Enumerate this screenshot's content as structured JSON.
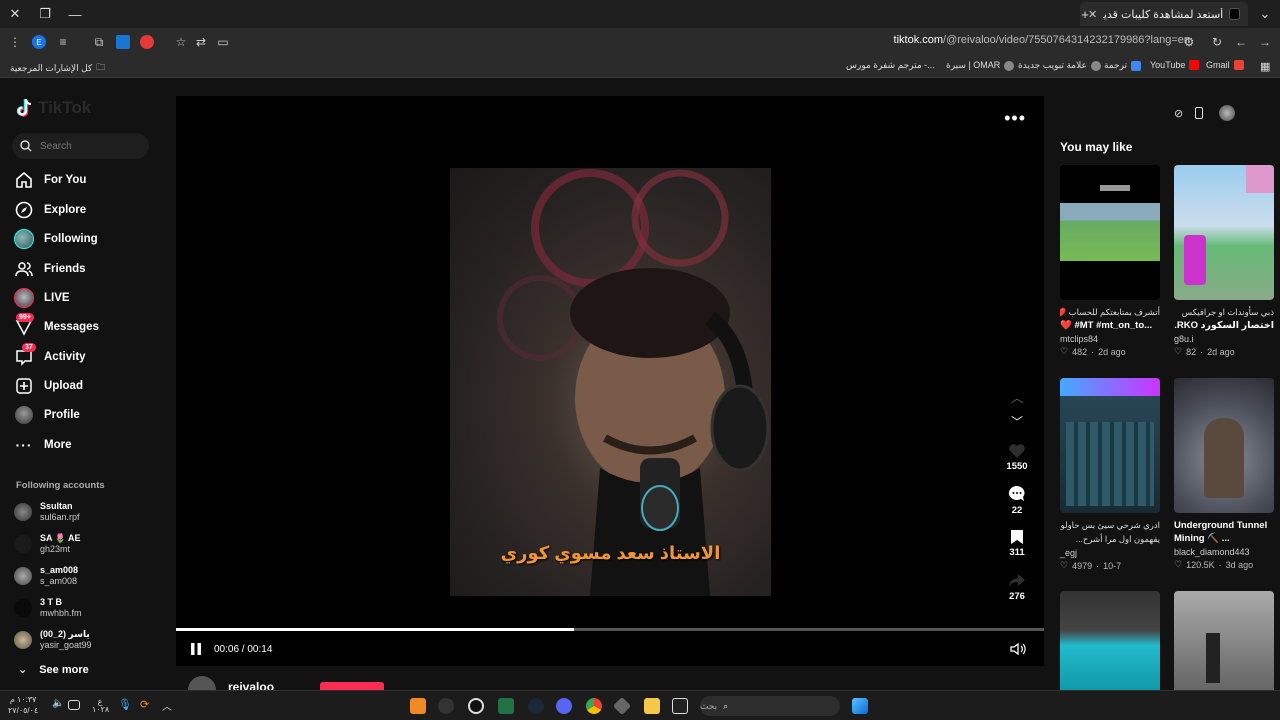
{
  "browser": {
    "tab_title": "أستعد لمشاهدة كليبات قديمة مع",
    "url_domain": "tiktok.com",
    "url_path": "/@reivaloo/video/7550764314232179986?lang=en",
    "bookmarks": [
      {
        "label": "Gmail",
        "color": "#ea4335"
      },
      {
        "label": "YouTube",
        "color": "#ff0000"
      },
      {
        "label": "ترجمة",
        "color": "#4285f4"
      },
      {
        "label": "علامة تبويب جديدة",
        "color": "#888888"
      },
      {
        "label": "سيرة | OMAR",
        "color": "#888888"
      },
      {
        "label": "مترجم شفرة مورس -...",
        "color": "#555555"
      }
    ],
    "all_bookmarks_label": "كل الإشارات المرجعية"
  },
  "sidebar": {
    "logo_text": "TikTok",
    "search_placeholder": "Search",
    "nav": [
      {
        "label": "For You",
        "icon": "home-icon"
      },
      {
        "label": "Explore",
        "icon": "compass-icon"
      },
      {
        "label": "Following",
        "icon": "avatar-icon"
      },
      {
        "label": "Friends",
        "icon": "friends-icon"
      },
      {
        "label": "LIVE",
        "icon": "live-icon"
      },
      {
        "label": "Messages",
        "icon": "messages-icon",
        "badge": "99+"
      },
      {
        "label": "Activity",
        "icon": "activity-icon",
        "badge": "37"
      },
      {
        "label": "Upload",
        "icon": "upload-icon"
      },
      {
        "label": "Profile",
        "icon": "profile-icon"
      },
      {
        "label": "More",
        "icon": "more-icon"
      }
    ],
    "following_title": "Following accounts",
    "accounts": [
      {
        "name": "Ssultan",
        "handle": "sul6an.rpf"
      },
      {
        "name": "SA 🌷 AE",
        "handle": "gh23mt"
      },
      {
        "name": "s_am008",
        "handle": "s_am008"
      },
      {
        "name": "3 T B",
        "handle": "mwhbh.fm"
      },
      {
        "name": "ياسر (2_00)",
        "handle": "yasir_goat99"
      }
    ],
    "see_more": "See more"
  },
  "video": {
    "caption": "الاستاذ سعد مسوي كوري",
    "likes": "1550",
    "comments": "22",
    "saves": "311",
    "shares": "276",
    "time": "00:06 / 00:14",
    "progress": 0.459,
    "author": "reivaloo"
  },
  "right_panel": {
    "title": "You may like",
    "cards": [
      {
        "line1": "أتشرف بمتابعتكم للحساب ❤️",
        "line2": "❤️ #MT #mt_on_to...",
        "author": "mtclips84",
        "likes": "482",
        "date": "2d ago",
        "thumb": "game"
      },
      {
        "line1": "ذبي سأوندات او جرافيكس",
        "line2": "اختصار السكورد RKO...",
        "author": "g8u.i",
        "likes": "82",
        "date": "2d ago",
        "thumb": "purple"
      },
      {
        "line1": "ادري شرحي سيئ بس حاولو",
        "line2": "يفهمون اول مرا أشرح...",
        "author": "_egj",
        "likes": "4979",
        "date": "10-7",
        "thumb": "mixer"
      },
      {
        "line1": "Underground Tunnel",
        "line2": "Mining ⛏️ ...",
        "author": "black_diamond443",
        "likes": "120.5K",
        "date": "3d ago",
        "thumb": "tunnel"
      },
      {
        "line1": "",
        "line2": "",
        "author": "",
        "likes": "",
        "date": "",
        "thumb": "arena"
      },
      {
        "line1": "",
        "line2": "",
        "author": "",
        "likes": "",
        "date": "",
        "thumb": "street"
      }
    ]
  },
  "taskbar": {
    "search_placeholder": "بحث",
    "time": "١٠:٣٧ م",
    "date": "٢٧/٠٥/٠٤",
    "lang": "ع",
    "lang2": "١٠٢٨"
  }
}
